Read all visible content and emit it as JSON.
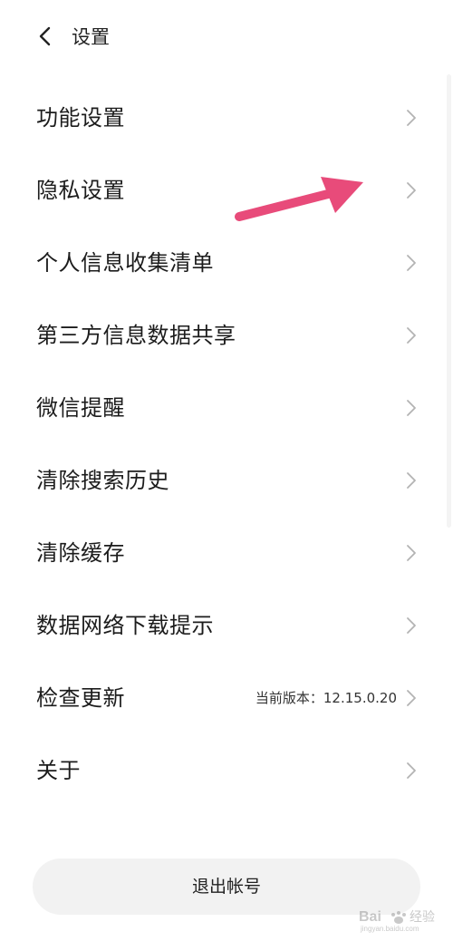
{
  "header": {
    "back_icon": "chevron-left-icon",
    "title": "设置"
  },
  "menu": {
    "items": [
      {
        "label": "功能设置"
      },
      {
        "label": "隐私设置"
      },
      {
        "label": "个人信息收集清单"
      },
      {
        "label": "第三方信息数据共享"
      },
      {
        "label": "微信提醒"
      },
      {
        "label": "清除搜索历史"
      },
      {
        "label": "清除缓存"
      },
      {
        "label": "数据网络下载提示"
      },
      {
        "label": "检查更新",
        "secondary": "当前版本：12.15.0.20"
      },
      {
        "label": "关于"
      }
    ],
    "chevron_icon": "chevron-right-icon"
  },
  "footer": {
    "logout_label": "退出帐号"
  },
  "annotation": {
    "color": "#e84b7a",
    "points_to": "隐私设置"
  },
  "watermark": {
    "text": "Bai 经验",
    "subtext": "jingyan.baidu.com"
  },
  "colors": {
    "background": "#ffffff",
    "text_primary": "#1c1c1c",
    "chevron": "#b3b3b3",
    "button_bg": "#f2f2f2"
  }
}
